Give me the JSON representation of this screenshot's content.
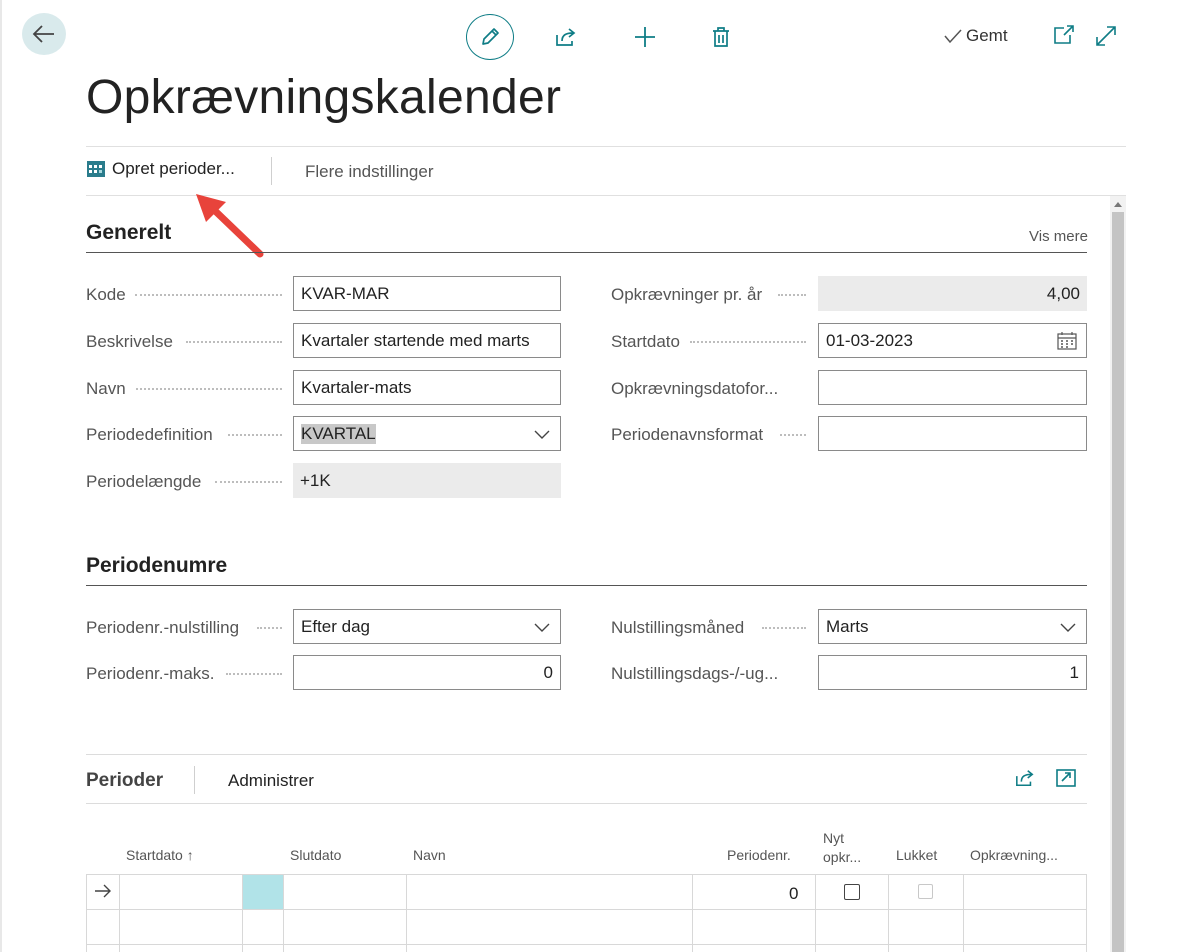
{
  "topbar": {
    "saved_label": "Gemt"
  },
  "page": {
    "title": "Opkrævningskalender"
  },
  "actions": {
    "create_periods": "Opret perioder...",
    "more_options": "Flere indstillinger"
  },
  "general": {
    "title": "Generelt",
    "show_more": "Vis mere",
    "fields": {
      "code_label": "Kode",
      "code_value": "KVAR-MAR",
      "description_label": "Beskrivelse",
      "description_value": "Kvartaler startende med marts",
      "name_label": "Navn",
      "name_value": "Kvartaler-mats",
      "period_def_label": "Periodedefinition",
      "period_def_value": "KVARTAL",
      "period_length_label": "Periodelængde",
      "period_length_value": "+1K",
      "collections_per_year_label": "Opkrævninger pr. år",
      "collections_per_year_value": "4,00",
      "start_date_label": "Startdato",
      "start_date_value": "01-03-2023",
      "collection_date_format_label": "Opkrævningsdatofor...",
      "collection_date_format_value": "",
      "period_name_format_label": "Periodenavnsformat",
      "period_name_format_value": ""
    }
  },
  "period_numbers": {
    "title": "Periodenumre",
    "fields": {
      "reset_label": "Periodenr.-nulstilling",
      "reset_value": "Efter dag",
      "max_label": "Periodenr.-maks.",
      "max_value": "0",
      "reset_month_label": "Nulstillingsmåned",
      "reset_month_value": "Marts",
      "reset_day_label": "Nulstillingsdags-/-ug...",
      "reset_day_value": "1"
    }
  },
  "periods_part": {
    "title": "Perioder",
    "manage": "Administrer",
    "columns": {
      "start_date": "Startdato ↑",
      "end_date": "Slutdato",
      "name": "Navn",
      "period_no": "Periodenr.",
      "new_collection_line1": "Nyt",
      "new_collection_line2": "opkr...",
      "closed": "Lukket",
      "collection": "Opkrævning..."
    },
    "rows": [
      {
        "period_no": "0",
        "new_collection_checked": false,
        "closed_checked": false
      }
    ]
  },
  "colors": {
    "accent": "#0f7d86",
    "selected_cell": "#b1e3e8",
    "annotation_arrow": "#e8433b"
  }
}
